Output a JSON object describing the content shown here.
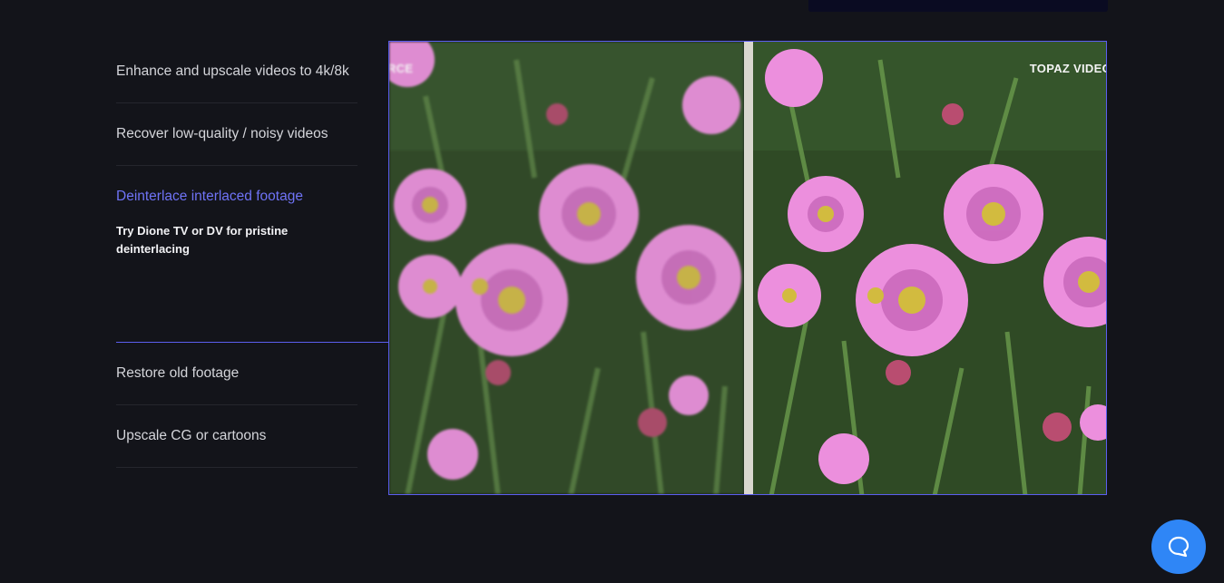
{
  "features": [
    {
      "label": "Enhance and upscale videos to 4k/8k"
    },
    {
      "label": "Recover low-quality / noisy videos"
    },
    {
      "label": "Deinterlace interlaced footage",
      "description": "Try Dione TV or DV for pristine deinterlacing",
      "active": true
    },
    {
      "label": "Restore old footage"
    },
    {
      "label": "Upscale CG or cartoons"
    }
  ],
  "comparison": {
    "left_tag": "IRCE",
    "right_tag": "TOPAZ VIDEO"
  },
  "colors": {
    "background": "#13141a",
    "accent": "#6f73f6",
    "chat_button": "#2f86f6"
  },
  "icons": {
    "chat": "chat-bubble-icon"
  }
}
